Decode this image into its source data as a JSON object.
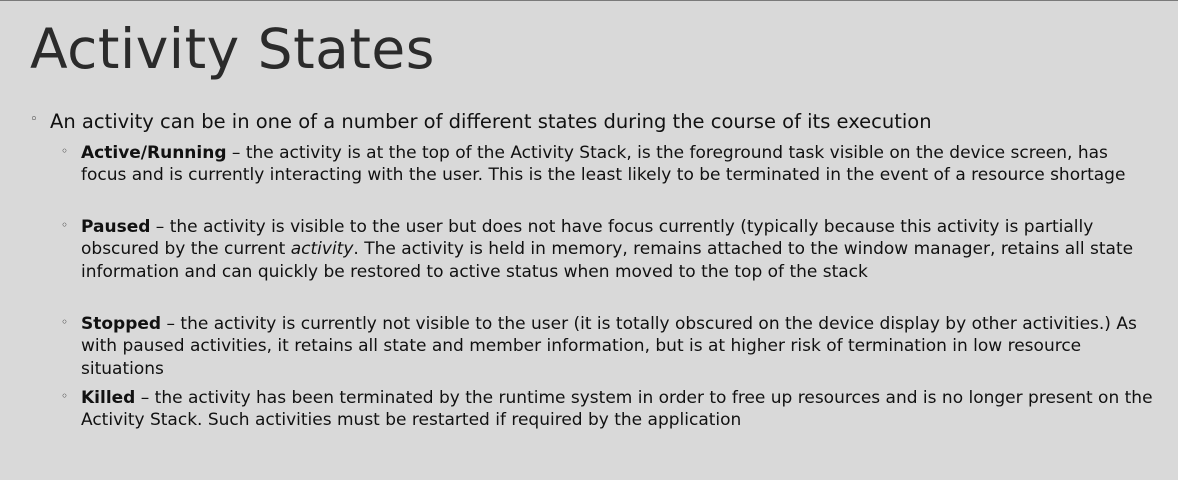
{
  "title": "Activity States",
  "intro": "An activity can be in one of a number of different states during the course of its execution",
  "items": [
    {
      "term": "Active/Running",
      "text": " – the activity is at the top of the Activity Stack, is the foreground task visible on the device screen, has focus and is currently interacting with the user.  This is the least likely to be terminated in the event of a resource shortage"
    },
    {
      "term": "Paused",
      "text_a": " – the activity is visible to the user but does not have focus currently (typically because this activity is partially obscured by the current ",
      "text_italic": "activity",
      "text_b": ".  The activity is held in memory, remains attached to the window manager, retains all state information and can quickly be restored to active status when moved to the top of the stack"
    },
    {
      "term": "Stopped",
      "text": " – the activity is currently not visible to the user (it is totally obscured on the device display by other activities.)  As with paused activities, it retains all state and member information, but is at higher risk of termination in low resource situations"
    },
    {
      "term": "Killed",
      "text": " – the activity has been terminated by the runtime system in order to free up resources and is no longer present on the Activity Stack.  Such activities must be restarted if required by the application"
    }
  ],
  "bullet_symbol": "◦"
}
